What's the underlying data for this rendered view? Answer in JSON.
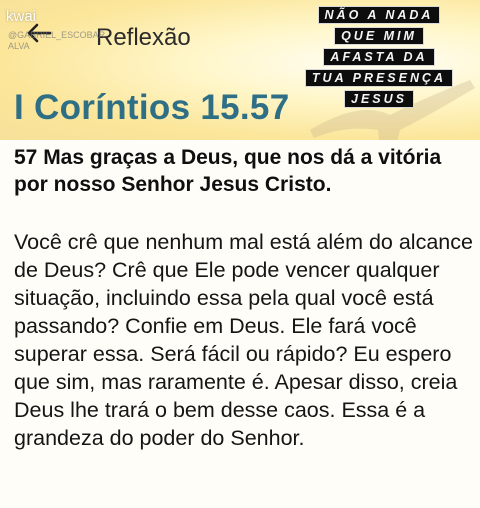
{
  "header": {
    "title": "Reflexão",
    "back_icon": "arrow-left-icon"
  },
  "watermark": {
    "brand": "kwai",
    "user_line1": "@GABRIEL_ESCOBAR",
    "user_line2": "ALVA"
  },
  "banner": {
    "lines": [
      "NÃO A NADA",
      "QUE MIM",
      "AFASTA DA",
      "TUA PRESENÇA",
      "JESUS"
    ]
  },
  "reference": "I Coríntios 15.57",
  "verse": "57 Mas graças a Deus, que nos dá a vitória por nosso Senhor Jesus Cristo.",
  "reflection": "Você crê que nenhum mal está além do alcance de Deus? Crê que Ele pode vencer qualquer situação, incluindo essa pela qual você está passando? Confie em Deus. Ele fará você superar essa. Será fácil ou rápido? Eu espero que sim, mas raramente é. Apesar disso, creia Deus lhe trará o bem desse caos. Essa é a grandeza do poder do Senhor.",
  "colors": {
    "reference": "#2e6f86",
    "banner_bg": "#0d0d0d",
    "hero": "#fbe69a"
  }
}
